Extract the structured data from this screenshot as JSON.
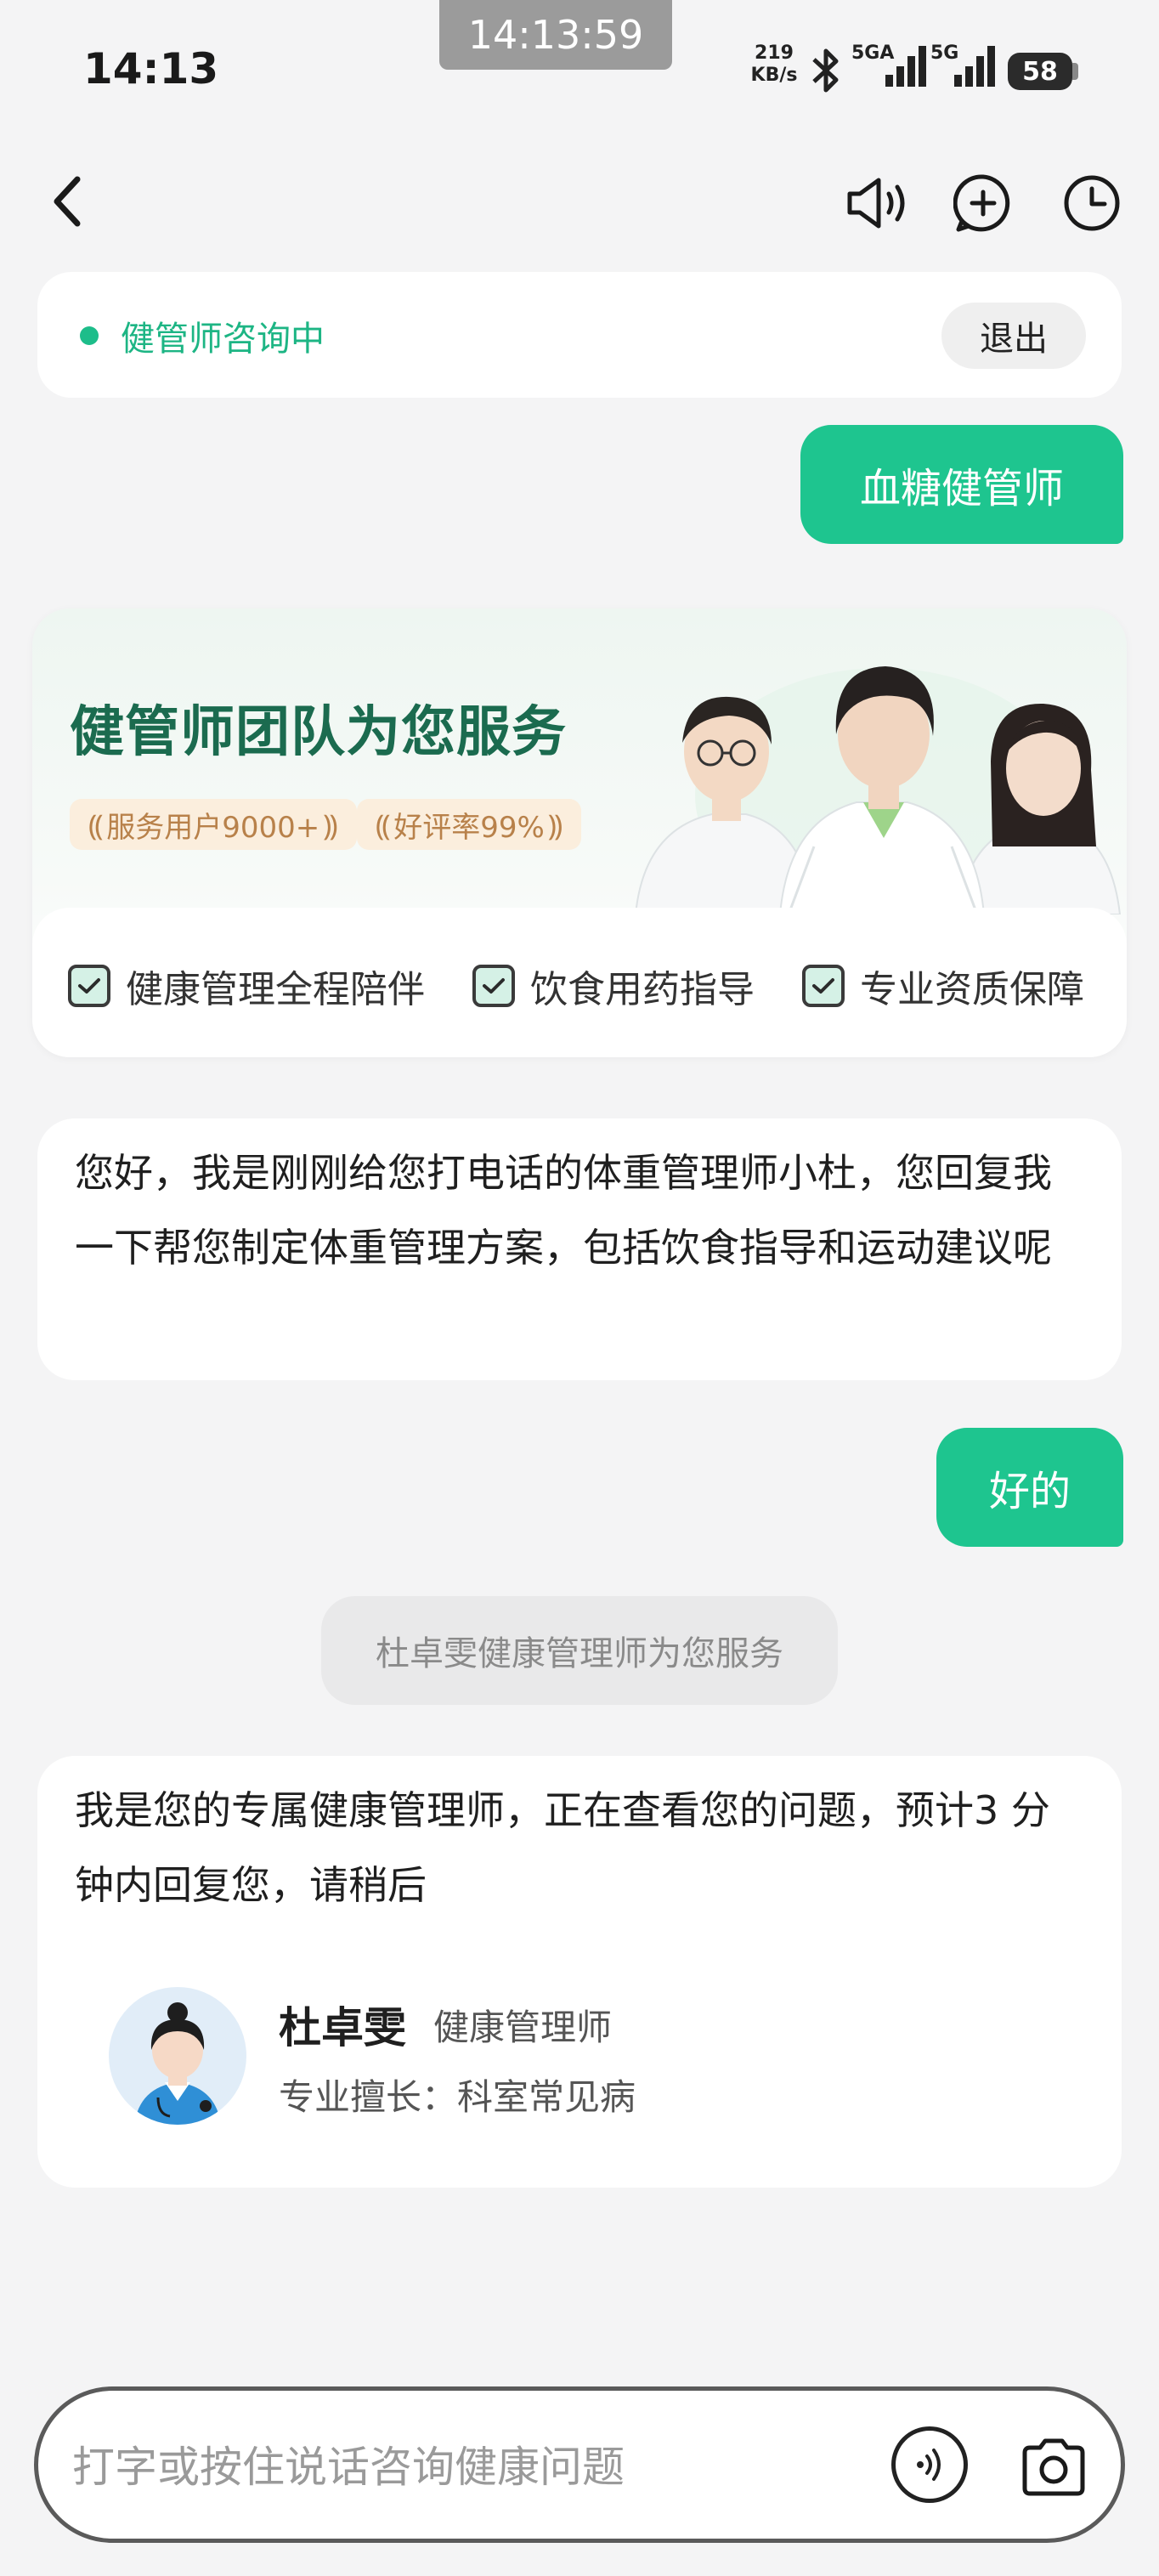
{
  "status_bar": {
    "time": "14:13",
    "recording_timer": "14:13:59",
    "net_speed_value": "219",
    "net_speed_unit": "KB/s",
    "signal1_label": "5GA",
    "signal2_label": "5G",
    "battery": "58"
  },
  "nav": {
    "back_icon": "chevron-left-icon",
    "speaker_icon": "speaker-icon",
    "new_chat_icon": "plus-circle-icon",
    "history_icon": "clock-icon"
  },
  "consult": {
    "status": "健管师咨询中",
    "exit_label": "退出",
    "status_color": "#1dbd8a"
  },
  "messages": {
    "user_1": "血糖健管师",
    "user_2": "好的",
    "bot_1": "您好，我是刚刚给您打电话的体重管理师小杜，您回复我一下帮您制定体重管理方案，包括饮食指导和运动建议呢",
    "system_1": "杜卓雯健康管理师为您服务",
    "bot_2": "我是您的专属健康管理师，正在查看您的问题，预计3 分钟内回复您，请稍后"
  },
  "team_card": {
    "title": "健管师团队为您服务",
    "badges": [
      "服务用户9000+",
      "好评率99%"
    ],
    "features": [
      "健康管理全程陪伴",
      "饮食用药指导",
      "专业资质保障"
    ]
  },
  "doctor": {
    "name": "杜卓雯",
    "role": "健康管理师",
    "specialty": "专业擅长：科室常见病"
  },
  "input": {
    "placeholder": "打字或按住说话咨询健康问题",
    "voice_icon": "voice-wave-icon",
    "camera_icon": "camera-icon"
  },
  "colors": {
    "accent": "#1ec58f",
    "title_green": "#1b6b4f",
    "badge_text": "#b8814a"
  }
}
